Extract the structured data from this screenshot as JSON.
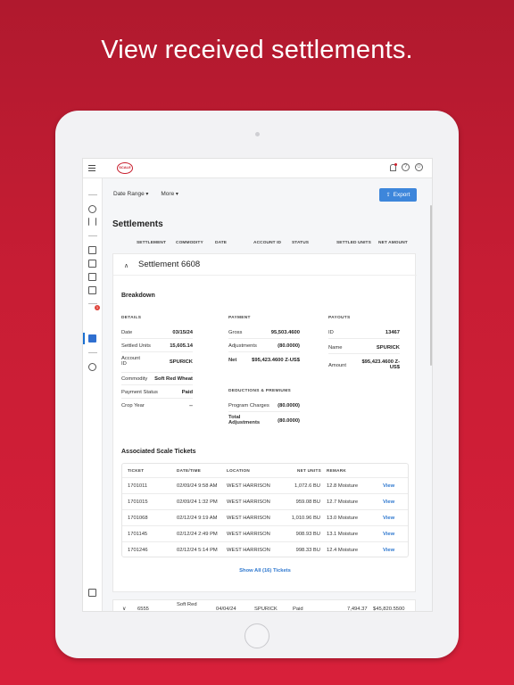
{
  "headline": "View received settlements.",
  "topbar": {
    "logo_text": "SCALE",
    "help_icon": "?",
    "user_icon": "☺"
  },
  "toolbar": {
    "date_range": "Date Range",
    "more": "More",
    "export": "Export",
    "export_icon": "⇪"
  },
  "page_title": "Settlements",
  "columns": [
    "SETTLEMENT",
    "COMMODITY",
    "DATE",
    "ACCOUNT ID",
    "STATUS",
    "SETTLED UNITS",
    "NET AMOUNT"
  ],
  "settlement": {
    "caret": "∧",
    "title": "Settlement 6608",
    "breakdown": "Breakdown",
    "details": {
      "heading": "DETAILS",
      "rows": [
        {
          "k": "Date",
          "v": "03/15/24"
        },
        {
          "k": "Settled Units",
          "v": "15,605.14"
        },
        {
          "k": "Account ID",
          "v": "SPURICK"
        },
        {
          "k": "Commodity",
          "v": "Soft Red Wheat"
        },
        {
          "k": "Payment Status",
          "v": "Paid"
        },
        {
          "k": "Crop Year",
          "v": "--"
        }
      ]
    },
    "payment": {
      "heading": "PAYMENT",
      "rows": [
        {
          "k": "Gross",
          "v": "95,503.4600"
        },
        {
          "k": "Adjustments",
          "v": "(80.0000)"
        },
        {
          "k": "Net",
          "v": "$95,423.4600 Z-US$"
        }
      ]
    },
    "deductions": {
      "heading": "DEDUCTIONS & PREMIUMS",
      "rows": [
        {
          "k": "Program Charges",
          "v": "(80.0000)"
        },
        {
          "k": "Total Adjustments",
          "v": "(80.0000)"
        }
      ]
    },
    "payouts": {
      "heading": "PAYOUTS",
      "rows": [
        {
          "k": "ID",
          "v": "13467"
        },
        {
          "k": "Name",
          "v": "SPURICK"
        },
        {
          "k": "Amount",
          "v": "$95,423.4600 Z-US$"
        }
      ]
    },
    "tickets": {
      "title": "Associated Scale Tickets",
      "headers": [
        "TICKET",
        "DATE/TIME",
        "LOCATION",
        "NET UNITS",
        "REMARK"
      ],
      "rows": [
        {
          "ticket": "1701011",
          "datetime": "02/09/24 9:58 AM",
          "location": "WEST HARRISON",
          "net": "1,072.6 BU",
          "remark": "12.8 Moisture",
          "action": "View"
        },
        {
          "ticket": "1701015",
          "datetime": "02/09/24 1:32 PM",
          "location": "WEST HARRISON",
          "net": "959.08 BU",
          "remark": "12.7 Moisture",
          "action": "View"
        },
        {
          "ticket": "1701068",
          "datetime": "02/12/24 9:19 AM",
          "location": "WEST HARRISON",
          "net": "1,010.96 BU",
          "remark": "13.0 Moisture",
          "action": "View"
        },
        {
          "ticket": "1701145",
          "datetime": "02/12/24 2:49 PM",
          "location": "WEST HARRISON",
          "net": "908.93 BU",
          "remark": "13.1 Moisture",
          "action": "View"
        },
        {
          "ticket": "1701246",
          "datetime": "02/12/24 5:14 PM",
          "location": "WEST HARRISON",
          "net": "998.33 BU",
          "remark": "12.4 Moisture",
          "action": "View"
        }
      ],
      "show_all": "Show All (16) Tickets"
    }
  },
  "next_row": {
    "caret": "∨",
    "settlement": "6555",
    "commodity": "Soft Red",
    "date": "04/04/24",
    "account": "SPURICK",
    "status": "Paid",
    "units": "7,494.37",
    "amount": "$45,820.5500"
  },
  "sidebar": {
    "badge": "1"
  }
}
